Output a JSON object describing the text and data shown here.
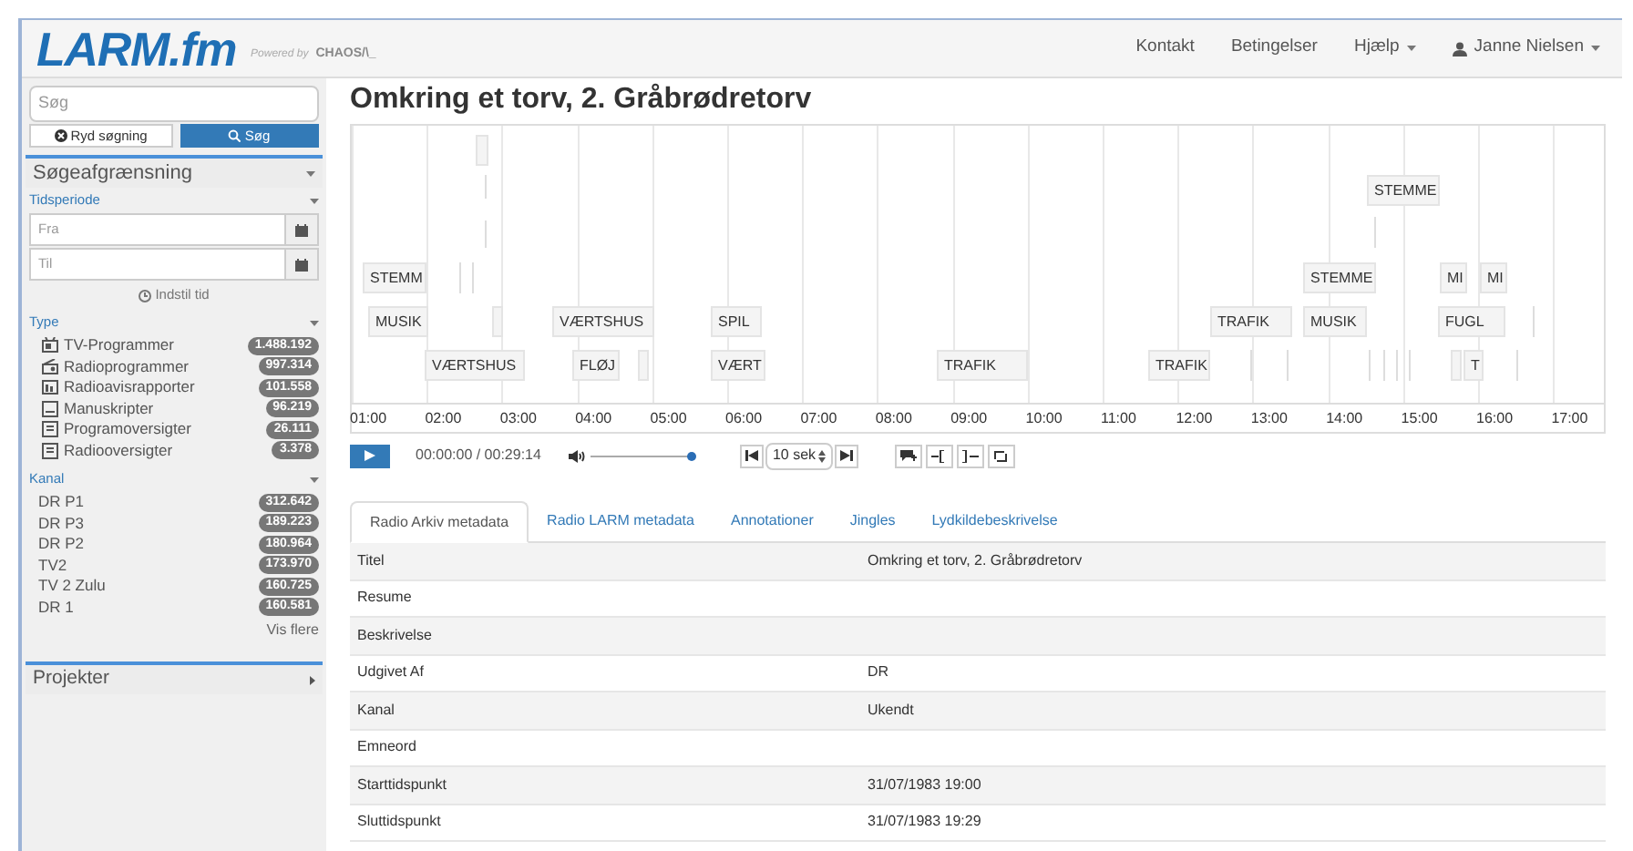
{
  "header": {
    "logo": "LARM.fm",
    "powered_by": "Powered by",
    "powered_brand": "CHAOS/\\_",
    "nav": [
      {
        "label": "Kontakt",
        "kind": "link"
      },
      {
        "label": "Betingelser",
        "kind": "link"
      },
      {
        "label": "Hjælp",
        "kind": "dropdown"
      },
      {
        "label": "Janne Nielsen",
        "kind": "user"
      }
    ]
  },
  "sidebar": {
    "search": {
      "placeholder": "Søg"
    },
    "clear_button": "Ryd søgning",
    "search_button": "Søg",
    "filter_title": "Søgeafgrænsning",
    "period": {
      "title": "Tidsperiode",
      "from_placeholder": "Fra",
      "to_placeholder": "Til",
      "set_time": "Indstil tid"
    },
    "type": {
      "title": "Type",
      "items": [
        {
          "label": "TV-Programmer",
          "count": "1.488.192",
          "kind": "tv"
        },
        {
          "label": "Radioprogrammer",
          "count": "997.314",
          "kind": "radio"
        },
        {
          "label": "Radioavisrapporter",
          "count": "101.558",
          "kind": "report"
        },
        {
          "label": "Manuskripter",
          "count": "96.219",
          "kind": "script"
        },
        {
          "label": "Programoversigter",
          "count": "26.111",
          "kind": "list"
        },
        {
          "label": "Radiooversigter",
          "count": "3.378",
          "kind": "list"
        }
      ]
    },
    "channel": {
      "title": "Kanal",
      "items": [
        {
          "label": "DR P1",
          "count": "312.642"
        },
        {
          "label": "DR P3",
          "count": "189.223"
        },
        {
          "label": "DR P2",
          "count": "180.964"
        },
        {
          "label": "TV2",
          "count": "173.970"
        },
        {
          "label": "TV 2 Zulu",
          "count": "160.725"
        },
        {
          "label": "DR 1",
          "count": "160.581"
        }
      ],
      "more": "Vis flere"
    },
    "projects_title": "Projekter"
  },
  "main": {
    "title": "Omkring et torv, 2. Gråbrødretorv",
    "timeline": {
      "segments": [
        {
          "label": "STEMM"
        },
        {
          "label": "MUSIK"
        },
        {
          "label": "VÆRTSHUS"
        },
        {
          "label": "VÆRTSHUS"
        },
        {
          "label": "FLØJ"
        },
        {
          "label": "SPIL"
        },
        {
          "label": "VÆRT"
        },
        {
          "label": "TRAFIK"
        },
        {
          "label": "TRAFIK"
        },
        {
          "label": "TRAFIK"
        },
        {
          "label": "MUSIK"
        },
        {
          "label": "STEMME"
        },
        {
          "label": "STEMME"
        },
        {
          "label": "MI"
        },
        {
          "label": "MI"
        },
        {
          "label": "FUGL"
        },
        {
          "label": "T"
        }
      ],
      "hours": [
        "01:00",
        "02:00",
        "03:00",
        "04:00",
        "05:00",
        "06:00",
        "07:00",
        "08:00",
        "09:00",
        "10:00",
        "11:00",
        "12:00",
        "13:00",
        "14:00",
        "15:00",
        "16:00",
        "17:00"
      ]
    },
    "player": {
      "time": "00:00:00 / 00:29:14",
      "volume": {
        "level": 1
      },
      "step": "10 sek"
    },
    "tabs": [
      {
        "label": "Radio Arkiv metadata",
        "selected": true
      },
      {
        "label": "Radio LARM metadata",
        "selected": false
      },
      {
        "label": "Annotationer",
        "selected": false
      },
      {
        "label": "Jingles",
        "selected": false
      },
      {
        "label": "Lydkildebeskrivelse",
        "selected": false
      }
    ],
    "metadata": [
      {
        "field": "Titel",
        "value": "Omkring et torv, 2. Gråbrødretorv"
      },
      {
        "field": "Resume"
      },
      {
        "field": "Beskrivelse"
      },
      {
        "field": "Udgivet Af",
        "value": "DR"
      },
      {
        "field": "Kanal",
        "value": "Ukendt"
      },
      {
        "field": "Emneord"
      },
      {
        "field": "Starttidspunkt",
        "value": "31/07/1983 19:00"
      },
      {
        "field": "Sluttidspunkt",
        "value": "31/07/1983 19:29"
      }
    ]
  }
}
